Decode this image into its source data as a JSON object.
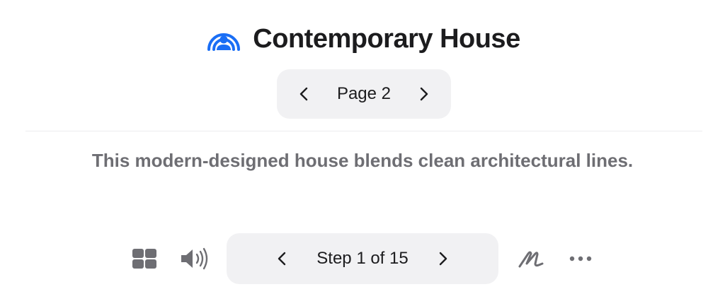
{
  "header": {
    "title": "Contemporary House",
    "icon": "listen-person-icon",
    "accent_color": "#1a6ef5"
  },
  "page_pager": {
    "label": "Page 2",
    "prev_icon": "chevron-left-icon",
    "next_icon": "chevron-right-icon"
  },
  "caption": "This modern-designed house blends clean architectural lines.",
  "toolbar": {
    "grid_icon": "grid-icon",
    "speaker_icon": "speaker-icon",
    "step_label": "Step 1 of 15",
    "draw_icon": "scribble-icon",
    "more_icon": "more-icon"
  }
}
